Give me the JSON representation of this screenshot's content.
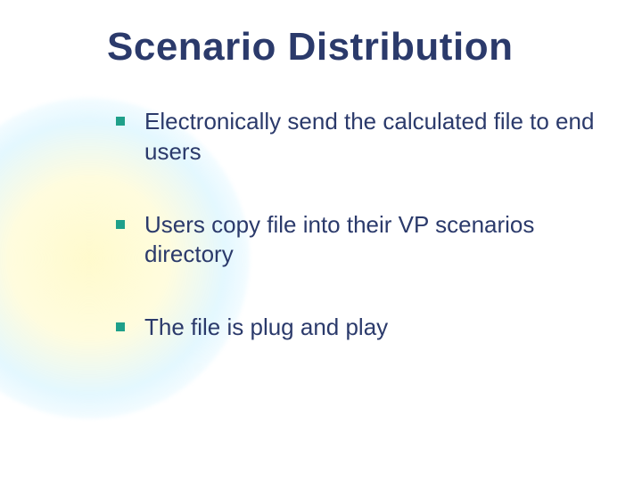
{
  "slide": {
    "title": "Scenario Distribution",
    "bullets": [
      "Electronically send the calculated file to end users",
      "Users copy file into their VP scenarios directory",
      "The file is plug and play"
    ]
  }
}
